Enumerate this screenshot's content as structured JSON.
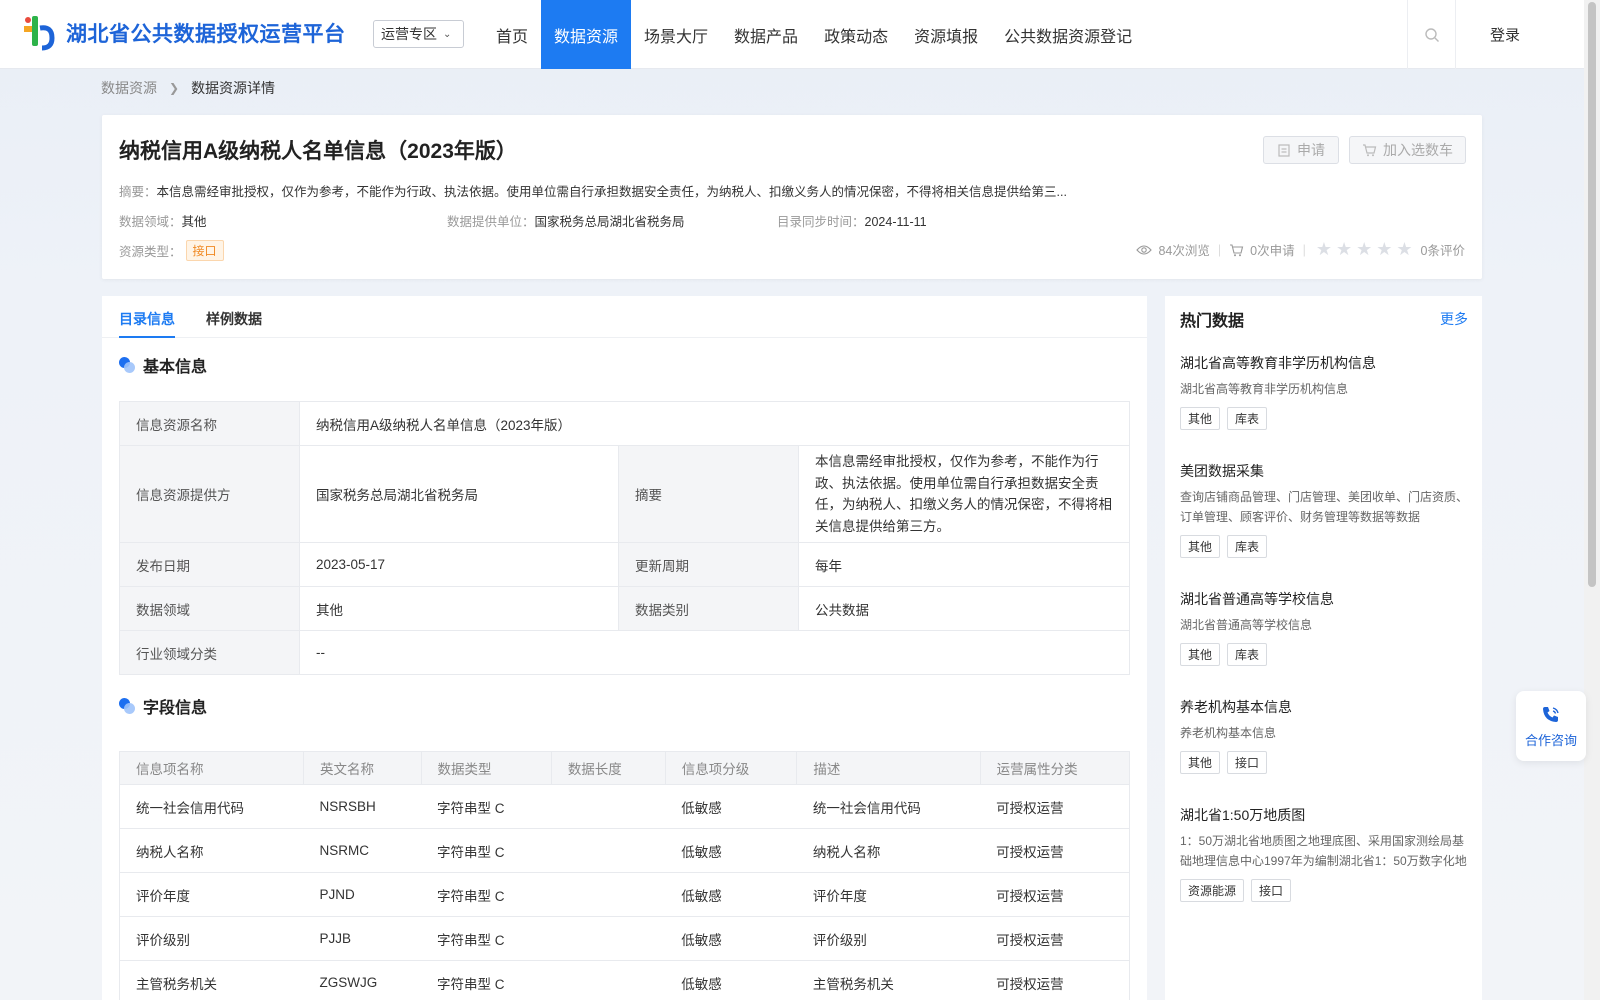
{
  "header": {
    "logo_text": "湖北省公共数据授权运营平台",
    "zone_select": "运营专区",
    "nav": [
      {
        "label": "首页",
        "active": false
      },
      {
        "label": "数据资源",
        "active": true
      },
      {
        "label": "场景大厅",
        "active": false
      },
      {
        "label": "数据产品",
        "active": false
      },
      {
        "label": "政策动态",
        "active": false
      },
      {
        "label": "资源填报",
        "active": false
      },
      {
        "label": "公共数据资源登记",
        "active": false
      }
    ],
    "login": "登录"
  },
  "breadcrumb": {
    "parent": "数据资源",
    "current": "数据资源详情"
  },
  "resource": {
    "title": "纳税信用A级纳税人名单信息（2023年版）",
    "apply_label": "申请",
    "cart_label": "加入选数车",
    "abstract_label": "摘要：",
    "abstract": "本信息需经审批授权，仅作为参考，不能作为行政、执法依据。使用单位需自行承担数据安全责任，为纳税人、扣缴义务人的情况保密，不得将相关信息提供给第三...",
    "domain_label": "数据领域：",
    "domain": "其他",
    "provider_label": "数据提供单位：",
    "provider": "国家税务总局湖北省税务局",
    "sync_label": "目录同步时间：",
    "sync_time": "2024-11-11",
    "type_label": "资源类型：",
    "type": "接口",
    "views": "84次浏览",
    "applies": "0次申请",
    "reviews": "0条评价",
    "rating": 0
  },
  "tabs": [
    {
      "label": "目录信息",
      "active": true
    },
    {
      "label": "样例数据",
      "active": false
    }
  ],
  "basic": {
    "title": "基本信息",
    "name_k": "信息资源名称",
    "name_v": "纳税信用A级纳税人名单信息（2023年版）",
    "provider_k": "信息资源提供方",
    "provider_v": "国家税务总局湖北省税务局",
    "abstract_k": "摘要",
    "abstract_v": "本信息需经审批授权，仅作为参考，不能作为行政、执法依据。使用单位需自行承担数据安全责任，为纳税人、扣缴义务人的情况保密，不得将相关信息提供给第三方。",
    "date_k": "发布日期",
    "date_v": "2023-05-17",
    "cycle_k": "更新周期",
    "cycle_v": "每年",
    "domain_k": "数据领域",
    "domain_v": "其他",
    "category_k": "数据类别",
    "category_v": "公共数据",
    "industry_k": "行业领域分类",
    "industry_v": "--"
  },
  "fields": {
    "title": "字段信息",
    "headers": [
      "信息项名称",
      "英文名称",
      "数据类型",
      "数据长度",
      "信息项分级",
      "描述",
      "运营属性分类"
    ],
    "rows": [
      [
        "统一社会信用代码",
        "NSRSBH",
        "字符串型 C",
        "",
        "低敏感",
        "统一社会信用代码",
        "可授权运营"
      ],
      [
        "纳税人名称",
        "NSRMC",
        "字符串型 C",
        "",
        "低敏感",
        "纳税人名称",
        "可授权运营"
      ],
      [
        "评价年度",
        "PJND",
        "字符串型 C",
        "",
        "低敏感",
        "评价年度",
        "可授权运营"
      ],
      [
        "评价级别",
        "PJJB",
        "字符串型 C",
        "",
        "低敏感",
        "评价级别",
        "可授权运营"
      ],
      [
        "主管税务机关",
        "ZGSWJG",
        "字符串型 C",
        "",
        "低敏感",
        "主管税务机关",
        "可授权运营"
      ]
    ]
  },
  "hot": {
    "title": "热门数据",
    "more": "更多",
    "items": [
      {
        "name": "湖北省高等教育非学历机构信息",
        "desc": "湖北省高等教育非学历机构信息",
        "tags": [
          "其他",
          "库表"
        ]
      },
      {
        "name": "美团数据采集",
        "desc": "查询店铺商品管理、门店管理、美团收单、门店资质、订单管理、顾客评价、财务管理等数据等数据",
        "tags": [
          "其他",
          "库表"
        ]
      },
      {
        "name": "湖北省普通高等学校信息",
        "desc": "湖北省普通高等学校信息",
        "tags": [
          "其他",
          "库表"
        ]
      },
      {
        "name": "养老机构基本信息",
        "desc": "养老机构基本信息",
        "tags": [
          "其他",
          "接口"
        ]
      },
      {
        "name": "湖北省1:50万地质图",
        "desc": "1：50万湖北省地质图之地理底图、采用国家测绘局基础地理信息中心1997年为编制湖北省1：50万数字化地",
        "tags": [
          "资源能源",
          "接口"
        ]
      }
    ]
  },
  "consult": {
    "label": "合作咨询"
  },
  "colors": {
    "primary": "#1d7bf2",
    "brand": "#1d64d8",
    "tag_orange": "#f08a24"
  }
}
